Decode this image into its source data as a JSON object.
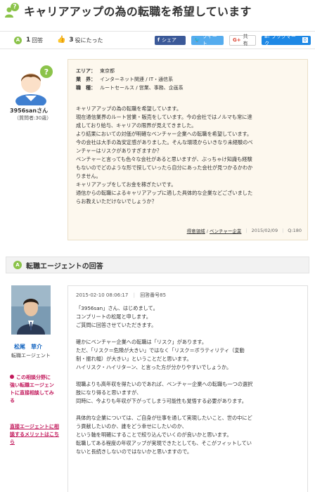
{
  "page": {
    "title": "キャリアアップの為の転職を希望しています"
  },
  "meta": {
    "answers_count": "1",
    "answers_label": "回答",
    "helpful_count": "3",
    "helpful_label": "役にたった",
    "share_facebook": "シェア",
    "share_twitter": "ツイート",
    "share_google": "共有",
    "share_hatena": "B! ブックマーク",
    "share_hatena_count": "0"
  },
  "question": {
    "asker_name": "3956sanさん",
    "asker_sub": "（質問者:30歳）",
    "area_label": "エリア：",
    "area_value": "東京都",
    "industry_label": "業　界：",
    "industry_value": "インターネット関連 / IT・通信系",
    "job_label": "職　種：",
    "job_value": "ルートセールス / 営業、事務、企画系",
    "body": "キャリアアップの為の転職を希望しています。\n現在通信業界のルート営業・販売をしています。今の会社ではノルマも常に達\n成しており給与、キャリアの限界が見えてきました。\nより結果においての対価が明確なベンチャー企業への転職を希望しています。\n今の会社は大手の為安定感がありました。そんな環境からいきなり未経験のベ\nンチャーはリスクがありすぎますか？\nベンチャーと言っても色々な会社があると思いますが、ぶっちゃけ知識も経験\nもないのでどのような形で探していったら自分にあった会社が見つかるかわか\nりません。\nキャリアアップをしてお金を稼ぎたいです。\n通信からの転職によるキャリアアップに適した具体的な企業などございました\nらお教えいただけないでしょうか？",
    "tag1": "得意領域",
    "tag2": "ベンチャー企業",
    "date": "2015/02/09",
    "qnum": "Q:180"
  },
  "answer_section": {
    "title": "転職エージェントの回答"
  },
  "agent": {
    "name": "松尾　草介",
    "role": "転職エージェント",
    "link1": "この相談分野に強い転職エージェントに直接相談してみる",
    "link2": "直接エージェントに相談するメリットはこちら"
  },
  "answer": {
    "datetime": "2015-02-10 08:06:17",
    "number": "回答番号85",
    "body": "「3956san」さん、はじめまして。\nコンプリートの松尾と申します。\nご質問に回答させていただきます。\n\n確かにベンチャー企業への転職は「リスク」があります。\nただ、「リスク＝危険が大きい」ではなく「リスク＝ボラティリティ（変動\n制・振れ幅）が大きい」ということだと思います。\nハイリスク・ハイリターン、と言った方が分かりやすいでしょうか。\n\n現職よりも高年収を得たいのであれば、ベンチャー企業への転職も一つの選択\n肢になり得ると思いますが、\n同時に、今よりも年収が下がってしまう可能性も覚悟する必要があります。\n\n具体的な企業については、ご自身が仕事を通して実現したいこと、世の中にど\nう貢献したいのか、誰をどう幸せにしたいのか、\nという軸を明確にすることで絞り込んでいくのが良いかと思います。\n転職してある程度の年収アップが実現できたとしても、そこがフィットしてい\nないと長続きしないのではないかと思いますので。"
  }
}
